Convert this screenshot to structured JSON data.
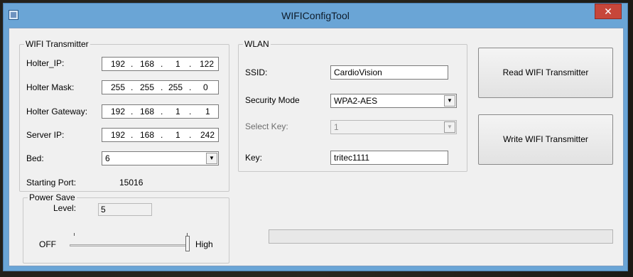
{
  "window": {
    "title": "WIFIConfigTool",
    "close_glyph": "✕"
  },
  "wifi_transmitter": {
    "legend": "WIFI Transmitter",
    "holter_ip_label": "Holter_IP:",
    "holter_ip": [
      "192",
      "168",
      "1",
      "122"
    ],
    "holter_mask_label": "Holter Mask:",
    "holter_mask": [
      "255",
      "255",
      "255",
      "0"
    ],
    "holter_gateway_label": "Holter Gateway:",
    "holter_gateway": [
      "192",
      "168",
      "1",
      "1"
    ],
    "server_ip_label": "Server IP:",
    "server_ip": [
      "192",
      "168",
      "1",
      "242"
    ],
    "bed_label": "Bed:",
    "bed_value": "6",
    "starting_port_label": "Starting Port:",
    "starting_port": "15016"
  },
  "wlan": {
    "legend": "WLAN",
    "ssid_label": "SSID:",
    "ssid": "CardioVision",
    "security_mode_label": "Security Mode",
    "security_mode": "WPA2-AES",
    "select_key_label": "Select Key:",
    "select_key": "1",
    "key_label": "Key:",
    "key": "tritec1111"
  },
  "buttons": {
    "read": "Read WIFI Transmitter",
    "write": "Write WIFI Transmitter"
  },
  "power_save": {
    "legend": "Power Save",
    "level_label": "Level:",
    "level": "5",
    "off_label": "OFF",
    "high_label": "High",
    "slider_fraction": 1.0
  },
  "progress": {
    "fraction": 0.0
  },
  "icons": {
    "app": "app-icon",
    "combo_arrow": "▼"
  }
}
